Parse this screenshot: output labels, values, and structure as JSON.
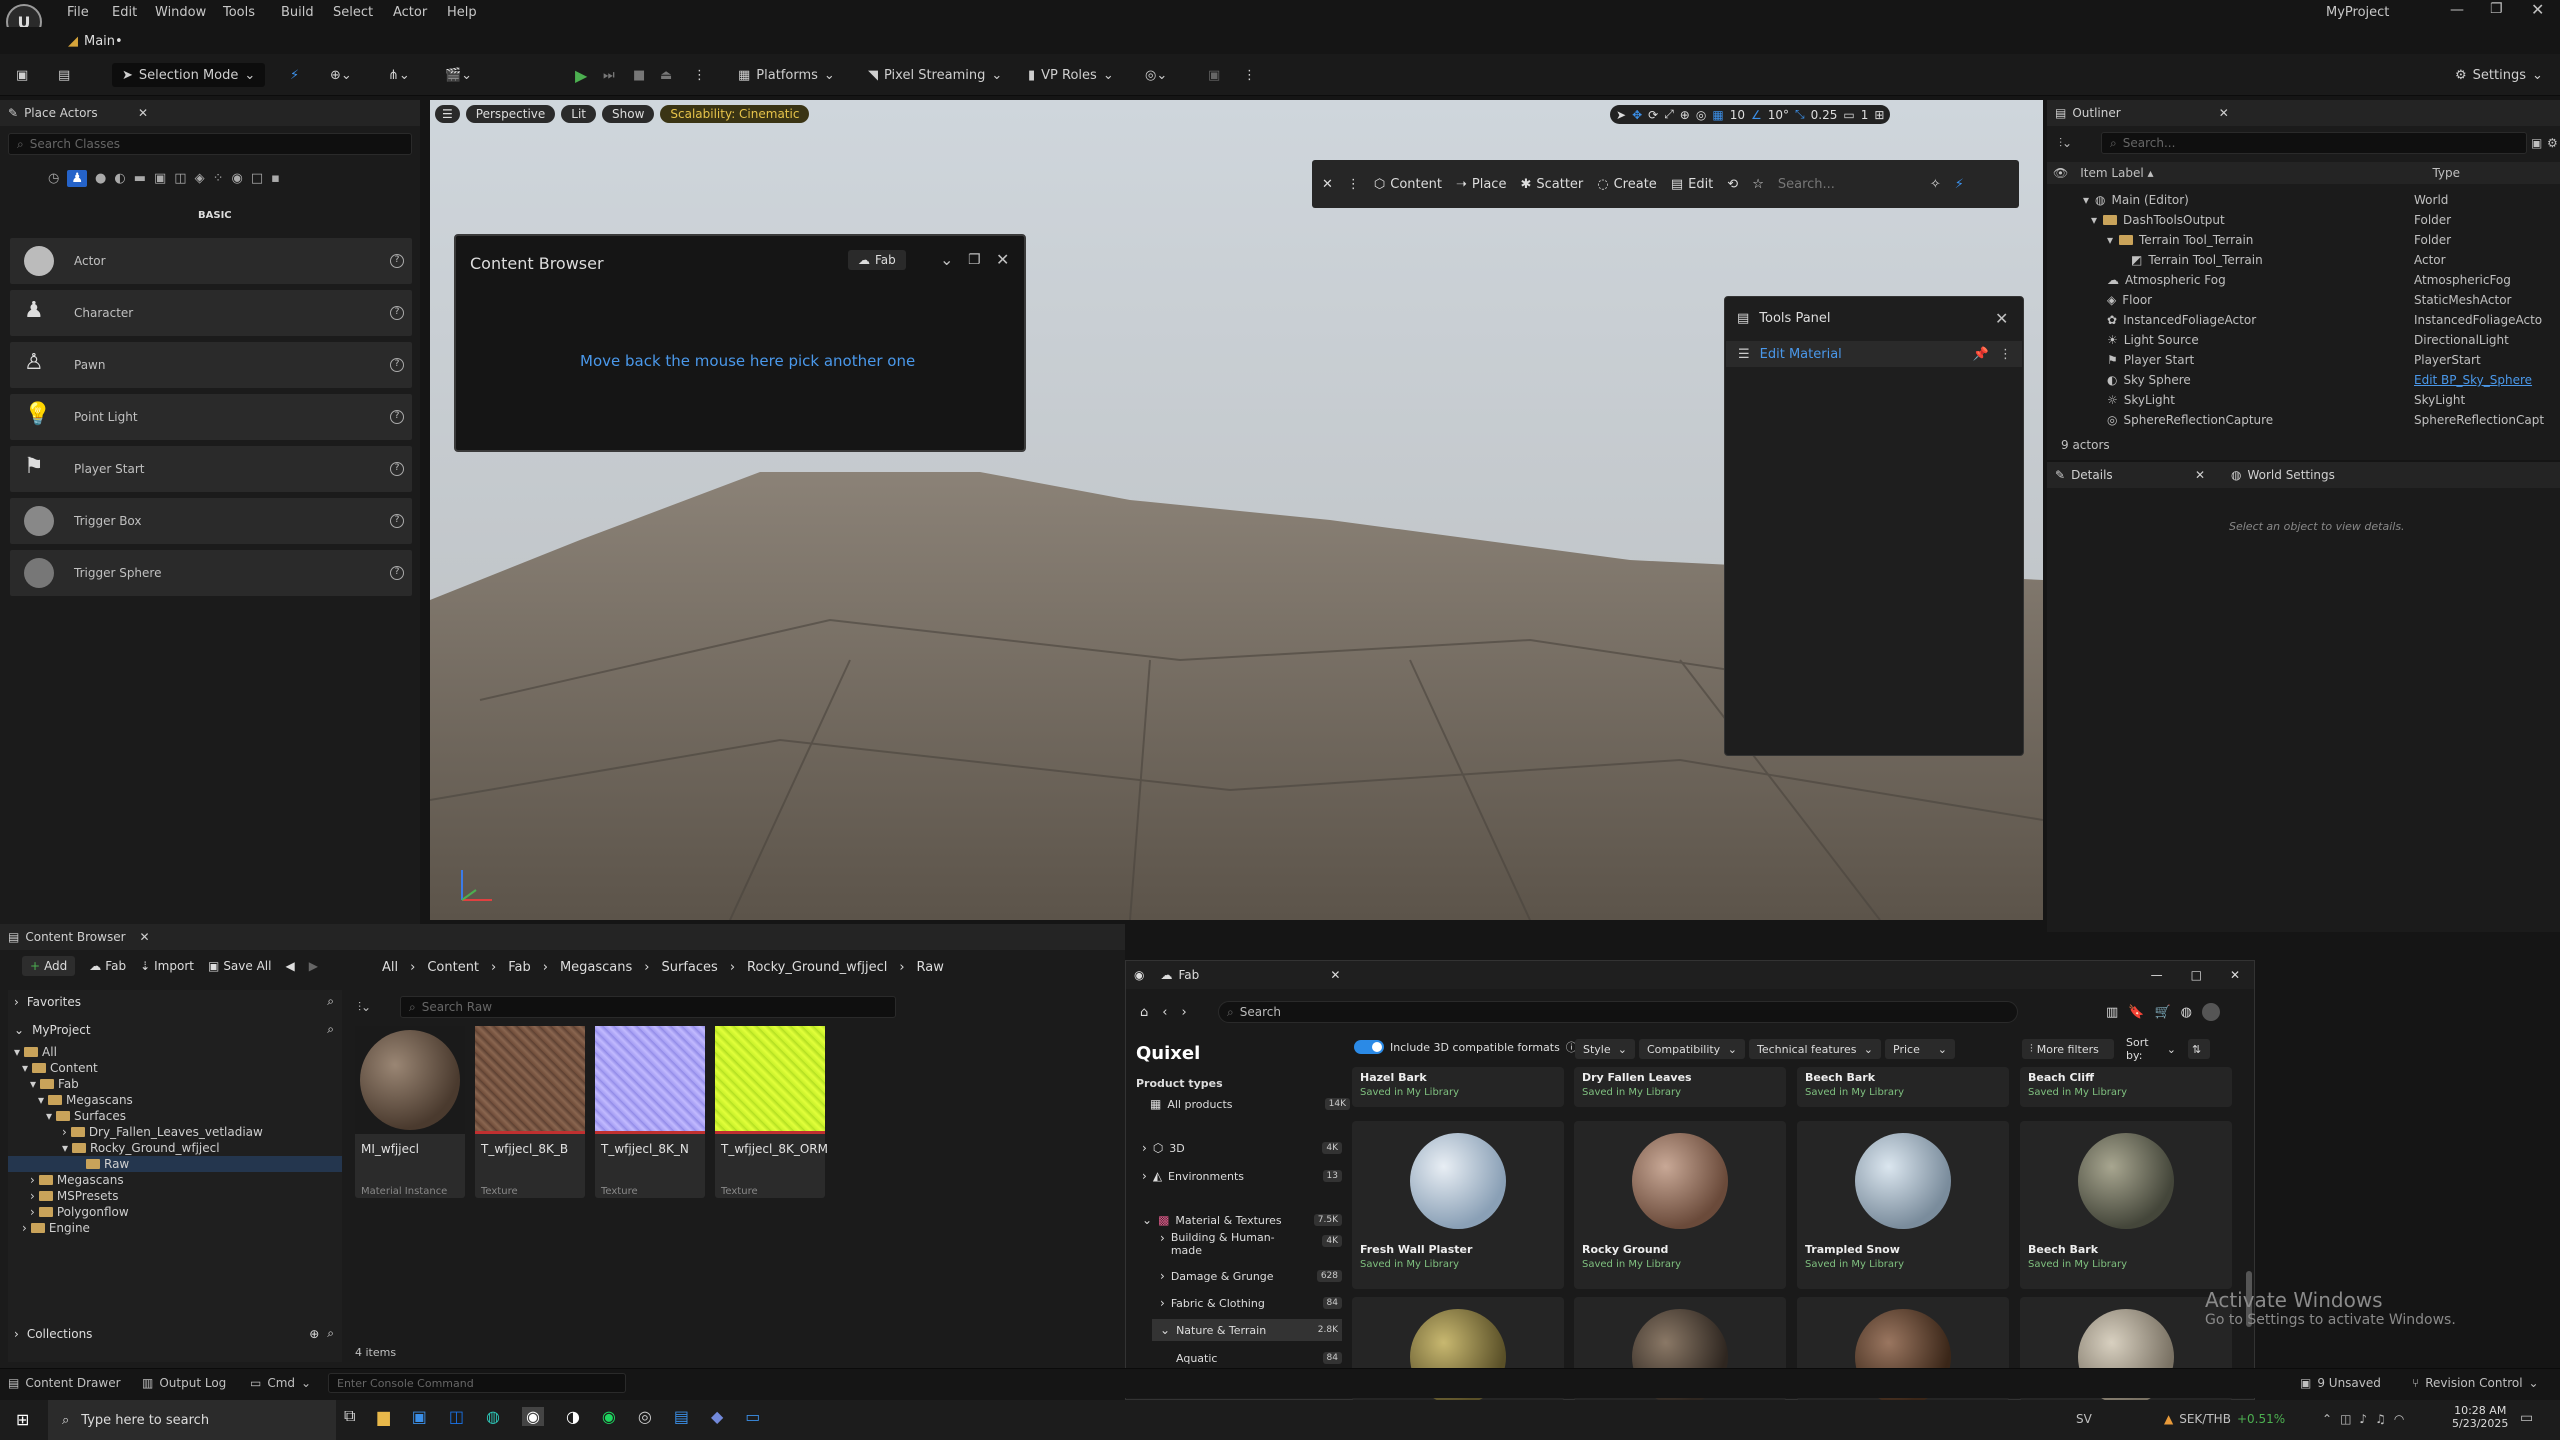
{
  "menu": {
    "items": [
      "File",
      "Edit",
      "Window",
      "Tools",
      "Build",
      "Select",
      "Actor",
      "Help"
    ],
    "project": "MyProject"
  },
  "tabs": {
    "main": "Main•"
  },
  "toolbar": {
    "selection_mode": "Selection Mode",
    "platforms": "Platforms",
    "pixel_streaming": "Pixel Streaming",
    "vp_roles": "VP Roles",
    "settings": "Settings"
  },
  "place_actors": {
    "tab": "Place Actors",
    "search_placeholder": "Search Classes",
    "section": "BASIC",
    "items": [
      "Actor",
      "Character",
      "Pawn",
      "Point Light",
      "Player Start",
      "Trigger Box",
      "Trigger Sphere"
    ]
  },
  "viewport": {
    "perspective": "Perspective",
    "lit": "Lit",
    "show": "Show",
    "scalability": "Scalability: Cinematic",
    "grid": "10",
    "angle": "10°",
    "scale": "0.25",
    "camera": "1",
    "mode_toolbar": {
      "content": "Content",
      "place": "Place",
      "scatter": "Scatter",
      "create": "Create",
      "edit": "Edit",
      "search_placeholder": "Search..."
    },
    "floating_cb": {
      "title": "Content Browser",
      "fab": "Fab",
      "message": "Move back the mouse here pick another one"
    },
    "tools_panel": {
      "title": "Tools Panel",
      "item": "Edit Material"
    }
  },
  "outliner": {
    "tab": "Outliner",
    "search_placeholder": "Search...",
    "col_label": "Item Label ▴",
    "col_type": "Type",
    "rows": [
      {
        "label": "Main (Editor)",
        "type": "World"
      },
      {
        "label": "DashToolsOutput",
        "type": "Folder"
      },
      {
        "label": "Terrain Tool_Terrain",
        "type": "Folder"
      },
      {
        "label": "Terrain Tool_Terrain",
        "type": "Actor"
      },
      {
        "label": "Atmospheric Fog",
        "type": "AtmosphericFog"
      },
      {
        "label": "Floor",
        "type": "StaticMeshActor"
      },
      {
        "label": "InstancedFoliageActor",
        "type": "InstancedFoliageActo"
      },
      {
        "label": "Light Source",
        "type": "DirectionalLight"
      },
      {
        "label": "Player Start",
        "type": "PlayerStart"
      },
      {
        "label": "Sky Sphere",
        "type": "Edit BP_Sky_Sphere"
      },
      {
        "label": "SkyLight",
        "type": "SkyLight"
      },
      {
        "label": "SphereReflectionCapture",
        "type": "SphereReflectionCapt"
      }
    ],
    "count": "9 actors"
  },
  "details": {
    "tab": "Details",
    "world_settings": "World Settings",
    "empty": "Select an object to view details."
  },
  "content_browser": {
    "tab": "Content Browser",
    "add": "Add",
    "fab": "Fab",
    "import": "Import",
    "save_all": "Save All",
    "breadcrumb": [
      "All",
      "Content",
      "Fab",
      "Megascans",
      "Surfaces",
      "Rocky_Ground_wfjjecl",
      "Raw"
    ],
    "favorites": "Favorites",
    "project": "MyProject",
    "search_placeholder": "Search Raw",
    "tree": [
      "All",
      "Content",
      "Fab",
      "Megascans",
      "Surfaces",
      "Dry_Fallen_Leaves_vetladiaw",
      "Rocky_Ground_wfjjecl",
      "Raw",
      "Megascans",
      "MSPresets",
      "Polygonflow",
      "Engine"
    ],
    "assets": [
      {
        "name": "MI_wfjjecl",
        "type": "Material Instance"
      },
      {
        "name": "T_wfjjecl_8K_B",
        "type": "Texture"
      },
      {
        "name": "T_wfjjecl_8K_N",
        "type": "Texture"
      },
      {
        "name": "T_wfjjecl_8K_ORM",
        "type": "Texture"
      }
    ],
    "collections": "Collections",
    "count": "4 items"
  },
  "fab": {
    "tab": "Fab",
    "search_placeholder": "Search",
    "brand": "Quixel",
    "include_3d": "Include 3D compatible formats",
    "filters": [
      "Style",
      "Compatibility",
      "Technical features",
      "Price"
    ],
    "more_filters": "More filters",
    "sort": "Sort by:",
    "product_types": "Product types",
    "sidebar": [
      {
        "label": "All products",
        "count": "14K"
      },
      {
        "label": "3D",
        "count": "4K"
      },
      {
        "label": "Environments",
        "count": "13"
      },
      {
        "label": "Material & Textures",
        "count": "7.5K"
      },
      {
        "label": "Building & Human-made",
        "count": "4K"
      },
      {
        "label": "Damage & Grunge",
        "count": "628"
      },
      {
        "label": "Fabric & Clothing",
        "count": "84"
      },
      {
        "label": "Nature & Terrain",
        "count": "2.8K"
      },
      {
        "label": "Aquatic",
        "count": "84"
      }
    ],
    "top_row": [
      "Hazel Bark",
      "Dry Fallen Leaves",
      "Beech Bark",
      "Beach Cliff"
    ],
    "cards": [
      "Fresh Wall Plaster",
      "Rocky Ground",
      "Trampled Snow",
      "Beech Bark"
    ],
    "saved": "Saved in My Library"
  },
  "status": {
    "content_drawer": "Content Drawer",
    "output_log": "Output Log",
    "cmd": "Cmd",
    "console_placeholder": "Enter Console Command",
    "unsaved": "9 Unsaved",
    "revision": "Revision Control"
  },
  "watermark": {
    "title": "Activate Windows",
    "sub": "Go to Settings to activate Windows."
  },
  "taskbar": {
    "search": "Type here to search",
    "lang": "SV",
    "ticker": "SEK/THB",
    "ticker_change": "+0.51%",
    "time": "10:28 AM",
    "date": "5/23/2025"
  }
}
